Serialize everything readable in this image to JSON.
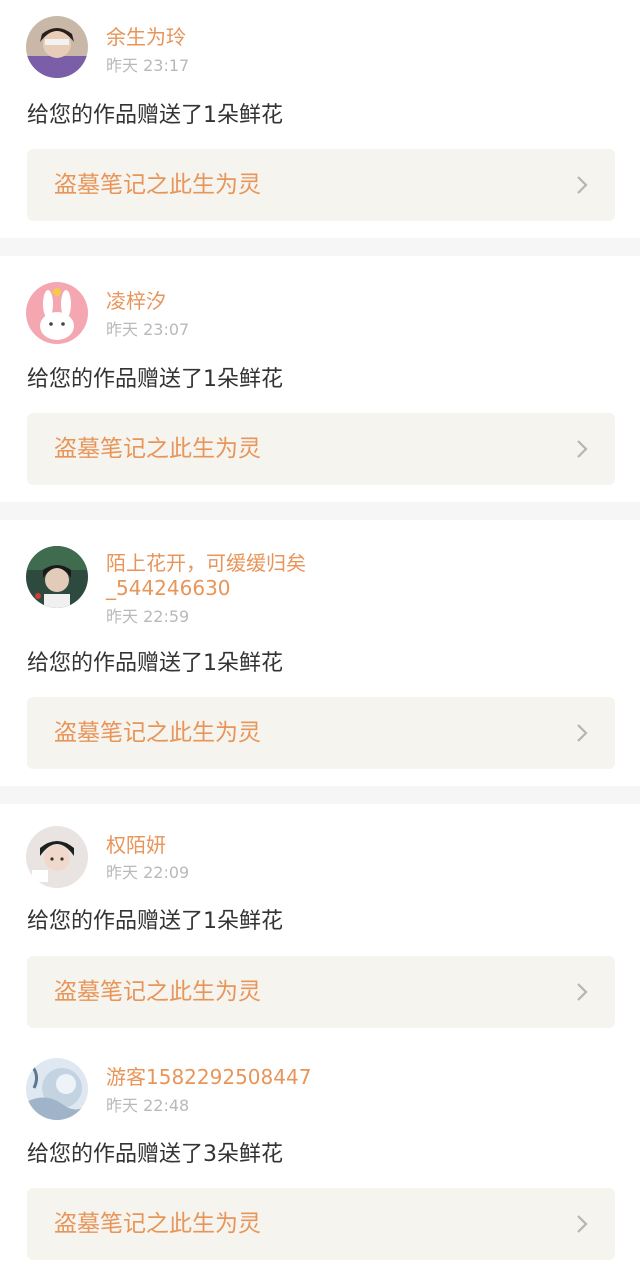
{
  "notifications": [
    {
      "username": "余生为玲",
      "time": "昨天 23:17",
      "message": "给您的作品赠送了1朵鲜花",
      "work_title": "盗墓笔记之此生为灵",
      "avatar_icon": "avatar-user-photo-icon"
    },
    {
      "username": "凌梓汐",
      "time": "昨天 23:07",
      "message": "给您的作品赠送了1朵鲜花",
      "work_title": "盗墓笔记之此生为灵",
      "avatar_icon": "avatar-bunny-icon"
    },
    {
      "username_line1": "陌上花开，可缓缓归矣",
      "username_line2": "_544246630",
      "time": "昨天 22:59",
      "message": "给您的作品赠送了1朵鲜花",
      "work_title": "盗墓笔记之此生为灵",
      "avatar_icon": "avatar-user-photo-icon"
    },
    {
      "username": "权陌妍",
      "time": "昨天 22:09",
      "message": "给您的作品赠送了1朵鲜花",
      "work_title": "盗墓笔记之此生为灵",
      "avatar_icon": "avatar-user-photo-icon"
    },
    {
      "username": "游客1582292508447",
      "time": "昨天 22:48",
      "message": "给您的作品赠送了3朵鲜花",
      "work_title": "盗墓笔记之此生为灵",
      "avatar_icon": "avatar-default-icon"
    }
  ],
  "colors": {
    "accent": "#e8955a",
    "card_link_bg": "#f5f4ee",
    "divider": "#f6f6f6",
    "timestamp": "#b9b9b9",
    "text": "#333333"
  }
}
